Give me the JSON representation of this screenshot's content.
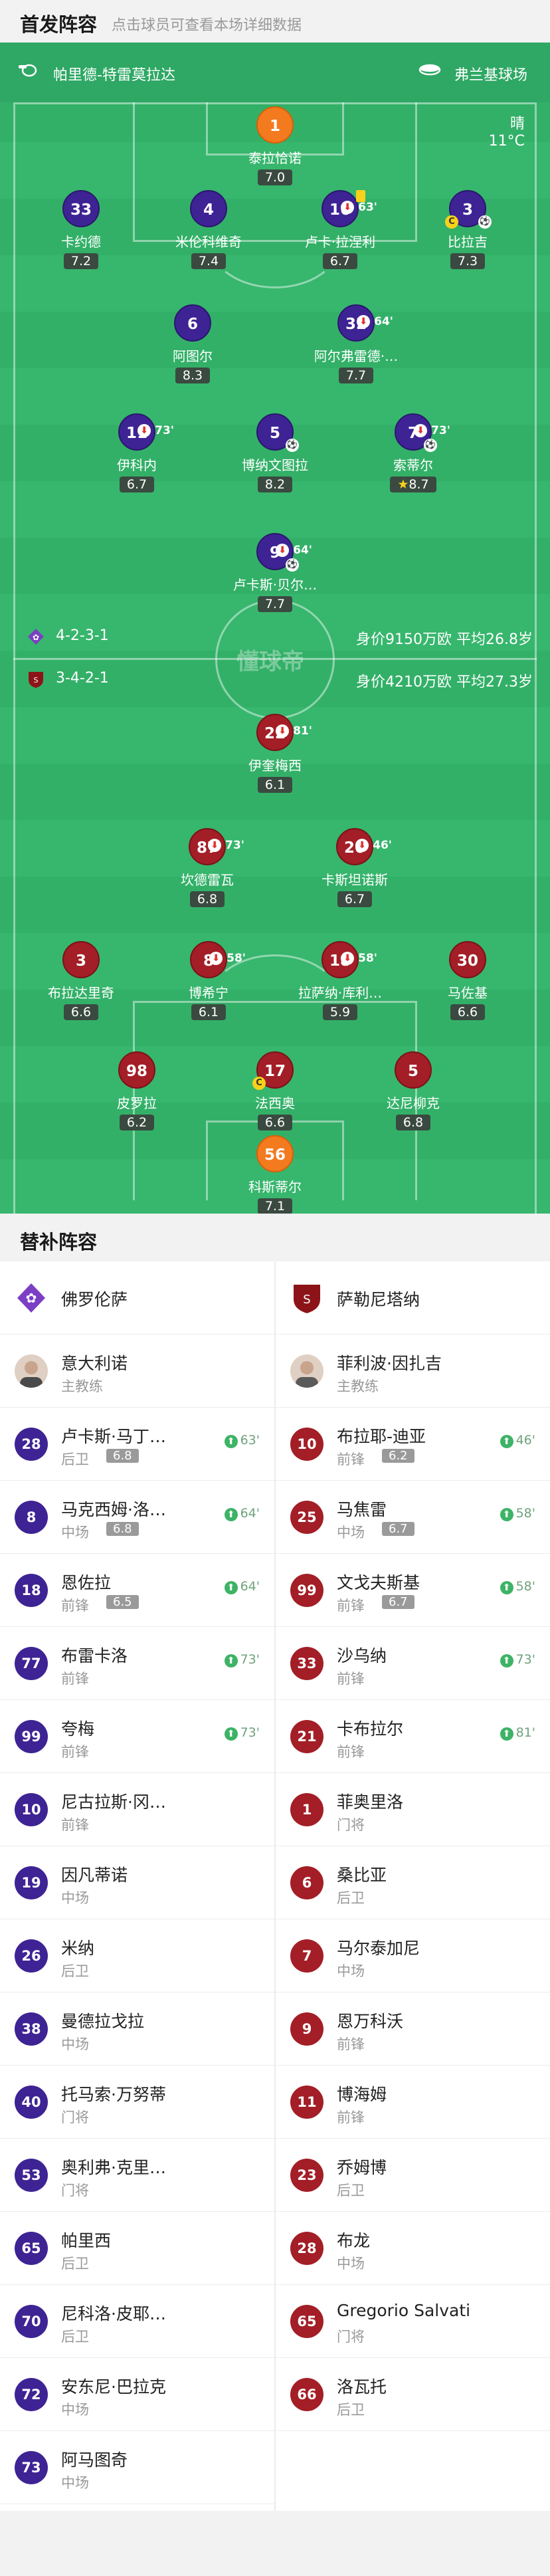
{
  "header": {
    "title": "首发阵容",
    "subtitle": "点击球员可查看本场详细数据"
  },
  "venue": {
    "referee": "帕里德-特雷莫拉达",
    "stadium": "弗兰基球场",
    "weather": "晴",
    "temp": "11°C"
  },
  "home": {
    "formation": "4-2-3-1",
    "value": "身价9150万欧",
    "avg_age": "平均26.8岁"
  },
  "away": {
    "formation": "3-4-2-1",
    "value": "身价4210万欧",
    "avg_age": "平均27.3岁"
  },
  "watermark": "懂球帝",
  "home_players": [
    {
      "num": "1",
      "name": "泰拉恰诺",
      "rating": "7.0",
      "sub": ""
    },
    {
      "num": "33",
      "name": "卡约德",
      "rating": "7.2",
      "sub": ""
    },
    {
      "num": "4",
      "name": "米伦科维奇",
      "rating": "7.4",
      "sub": ""
    },
    {
      "num": "16",
      "name": "卢卡·拉涅利",
      "rating": "6.7",
      "sub": "63'"
    },
    {
      "num": "3",
      "name": "比拉吉",
      "rating": "7.3",
      "sub": ""
    },
    {
      "num": "6",
      "name": "阿图尔",
      "rating": "8.3",
      "sub": ""
    },
    {
      "num": "32",
      "name": "阿尔弗雷德·…",
      "rating": "7.7",
      "sub": "64'"
    },
    {
      "num": "11",
      "name": "伊科内",
      "rating": "6.7",
      "sub": "73'"
    },
    {
      "num": "5",
      "name": "博纳文图拉",
      "rating": "8.2",
      "sub": ""
    },
    {
      "num": "7",
      "name": "索蒂尔",
      "rating": "8.7",
      "sub": "73'"
    },
    {
      "num": "9",
      "name": "卢卡斯·贝尔…",
      "rating": "7.7",
      "sub": "64'"
    }
  ],
  "away_players": [
    {
      "num": "22",
      "name": "伊奎梅西",
      "rating": "6.1",
      "sub": "81'"
    },
    {
      "num": "87",
      "name": "坎德雷瓦",
      "rating": "6.8",
      "sub": "73'"
    },
    {
      "num": "20",
      "name": "卡斯坦诺斯",
      "rating": "6.7",
      "sub": "46'"
    },
    {
      "num": "3",
      "name": "布拉达里奇",
      "rating": "6.6",
      "sub": ""
    },
    {
      "num": "8",
      "name": "博希宁",
      "rating": "6.1",
      "sub": "58'"
    },
    {
      "num": "18",
      "name": "拉萨纳·库利…",
      "rating": "5.9",
      "sub": "58'"
    },
    {
      "num": "30",
      "name": "马佐基",
      "rating": "6.6",
      "sub": ""
    },
    {
      "num": "98",
      "name": "皮罗拉",
      "rating": "6.2",
      "sub": ""
    },
    {
      "num": "17",
      "name": "法西奥",
      "rating": "6.6",
      "sub": ""
    },
    {
      "num": "5",
      "name": "达尼柳克",
      "rating": "6.8",
      "sub": ""
    },
    {
      "num": "56",
      "name": "科斯蒂尔",
      "rating": "7.1",
      "sub": ""
    }
  ],
  "subs": {
    "title": "替补阵容",
    "home_team": "佛罗伦萨",
    "away_team": "萨勒尼塔纳",
    "home_coach": {
      "name": "意大利诺",
      "role": "主教练"
    },
    "away_coach": {
      "name": "菲利波·因扎吉",
      "role": "主教练"
    },
    "home": [
      {
        "num": "28",
        "name": "卢卡斯·马丁…",
        "pos": "后卫",
        "rating": "6.8",
        "sub": "63'"
      },
      {
        "num": "8",
        "name": "马克西姆·洛…",
        "pos": "中场",
        "rating": "6.8",
        "sub": "64'"
      },
      {
        "num": "18",
        "name": "恩佐拉",
        "pos": "前锋",
        "rating": "6.5",
        "sub": "64'"
      },
      {
        "num": "77",
        "name": "布雷卡洛",
        "pos": "前锋",
        "rating": "",
        "sub": "73'"
      },
      {
        "num": "99",
        "name": "夸梅",
        "pos": "前锋",
        "rating": "",
        "sub": "73'"
      },
      {
        "num": "10",
        "name": "尼古拉斯·冈…",
        "pos": "前锋",
        "rating": "",
        "sub": ""
      },
      {
        "num": "19",
        "name": "因凡蒂诺",
        "pos": "中场",
        "rating": "",
        "sub": ""
      },
      {
        "num": "26",
        "name": "米纳",
        "pos": "后卫",
        "rating": "",
        "sub": ""
      },
      {
        "num": "38",
        "name": "曼德拉戈拉",
        "pos": "中场",
        "rating": "",
        "sub": ""
      },
      {
        "num": "40",
        "name": "托马索·万努蒂",
        "pos": "门将",
        "rating": "",
        "sub": ""
      },
      {
        "num": "53",
        "name": "奥利弗·克里…",
        "pos": "门将",
        "rating": "",
        "sub": ""
      },
      {
        "num": "65",
        "name": "帕里西",
        "pos": "后卫",
        "rating": "",
        "sub": ""
      },
      {
        "num": "70",
        "name": "尼科洛·皮耶…",
        "pos": "后卫",
        "rating": "",
        "sub": ""
      },
      {
        "num": "72",
        "name": "安东尼·巴拉克",
        "pos": "中场",
        "rating": "",
        "sub": ""
      },
      {
        "num": "73",
        "name": "阿马图奇",
        "pos": "中场",
        "rating": "",
        "sub": ""
      }
    ],
    "away": [
      {
        "num": "10",
        "name": "布拉耶-迪亚",
        "pos": "前锋",
        "rating": "6.2",
        "sub": "46'"
      },
      {
        "num": "25",
        "name": "马焦雷",
        "pos": "中场",
        "rating": "6.7",
        "sub": "58'"
      },
      {
        "num": "99",
        "name": "文戈夫斯基",
        "pos": "前锋",
        "rating": "6.7",
        "sub": "58'"
      },
      {
        "num": "33",
        "name": "沙乌纳",
        "pos": "前锋",
        "rating": "",
        "sub": "73'"
      },
      {
        "num": "21",
        "name": "卡布拉尔",
        "pos": "前锋",
        "rating": "",
        "sub": "81'"
      },
      {
        "num": "1",
        "name": "菲奥里洛",
        "pos": "门将",
        "rating": "",
        "sub": ""
      },
      {
        "num": "6",
        "name": "桑比亚",
        "pos": "后卫",
        "rating": "",
        "sub": ""
      },
      {
        "num": "7",
        "name": "马尔泰加尼",
        "pos": "中场",
        "rating": "",
        "sub": ""
      },
      {
        "num": "9",
        "name": "恩万科沃",
        "pos": "前锋",
        "rating": "",
        "sub": ""
      },
      {
        "num": "11",
        "name": "博海姆",
        "pos": "前锋",
        "rating": "",
        "sub": ""
      },
      {
        "num": "23",
        "name": "乔姆博",
        "pos": "后卫",
        "rating": "",
        "sub": ""
      },
      {
        "num": "28",
        "name": "布龙",
        "pos": "中场",
        "rating": "",
        "sub": ""
      },
      {
        "num": "65",
        "name": "Gregorio Salvati",
        "pos": "门将",
        "rating": "",
        "sub": ""
      },
      {
        "num": "66",
        "name": "洛瓦托",
        "pos": "后卫",
        "rating": "",
        "sub": ""
      }
    ]
  },
  "colors": {
    "home": "#3e2394",
    "away": "#a31e26",
    "gk_home": "#f47a1f",
    "gk_away": "#f47a1f",
    "pitch": "#33b068"
  }
}
